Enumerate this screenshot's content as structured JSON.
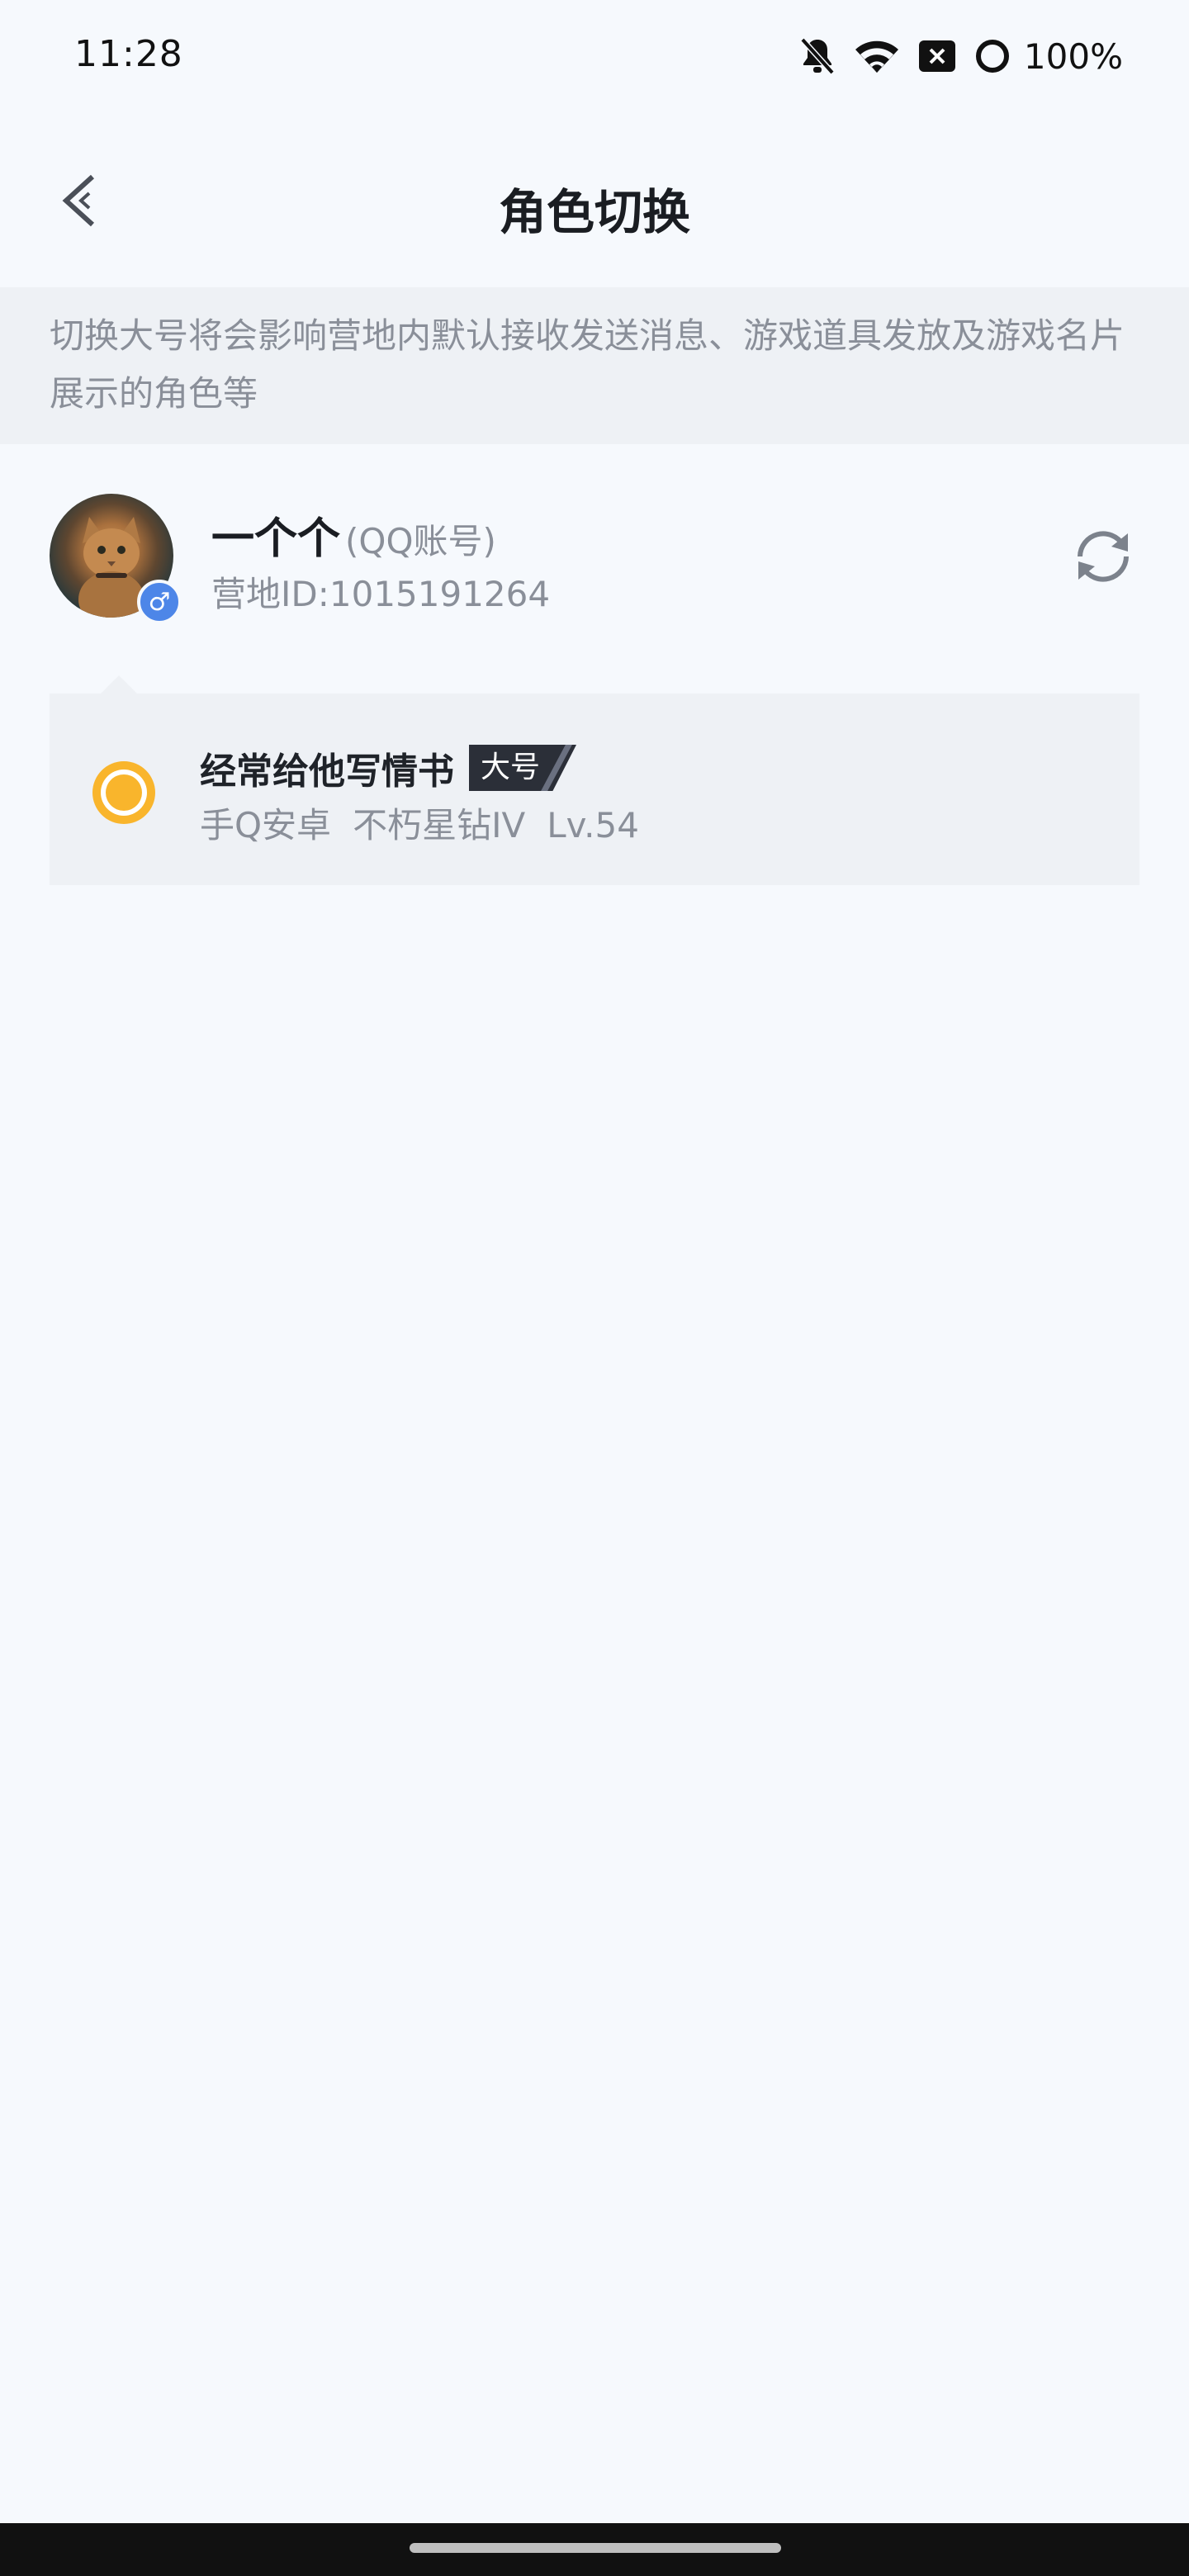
{
  "status_bar": {
    "time": "11:28",
    "battery": "100%",
    "icons": [
      "bell-off-icon",
      "wifi-icon",
      "sim-x-icon",
      "circle-icon"
    ]
  },
  "header": {
    "title": "角色切换",
    "back_icon": "chevron-left-icon"
  },
  "notice": {
    "text": "切换大号将会影响营地内默认接收发送消息、游戏道具发放及游戏名片展示的角色等"
  },
  "account": {
    "name": "一个个",
    "type": "(QQ账号)",
    "camp_id": "营地ID:1015191264",
    "gender_symbol": "♂",
    "switch_icon": "refresh-icon"
  },
  "roles": [
    {
      "name": "经常给他写情书",
      "badge": "大号",
      "platform": "手Q安卓",
      "rank": "不朽星钻IV",
      "level": "Lv.54",
      "selected": true
    }
  ],
  "colors": {
    "background": "#f6f9fd",
    "notice_bg": "#eef1f5",
    "accent_yellow": "#f9b52c",
    "badge_dark": "#2b2f38",
    "gender_blue": "#4d86e8",
    "muted_text": "#8a8f99"
  }
}
